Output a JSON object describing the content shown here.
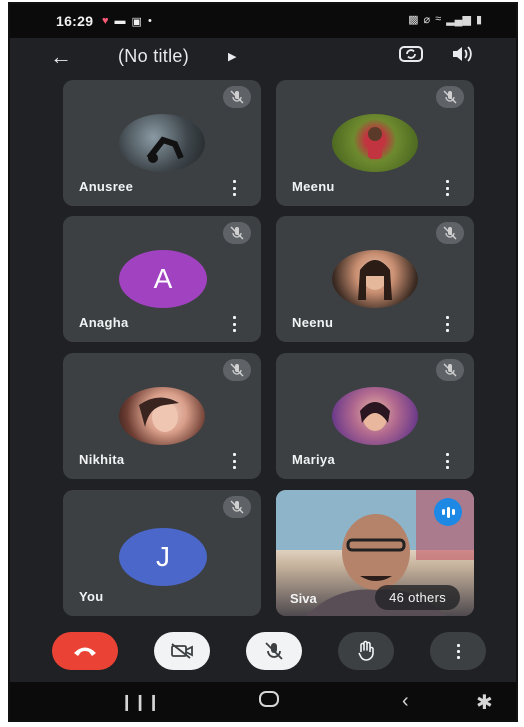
{
  "status_bar": {
    "time": "16:29"
  },
  "header": {
    "back_icon": "arrow-left-icon",
    "title": "(No title)"
  },
  "participants": [
    {
      "name": "Anusree",
      "avatar": "photo",
      "muted": true
    },
    {
      "name": "Meenu",
      "avatar": "photo",
      "muted": true
    },
    {
      "name": "Anagha",
      "avatar_letter": "A",
      "avatar_color": "#a142c0",
      "muted": true
    },
    {
      "name": "Neenu",
      "avatar": "photo",
      "muted": true
    },
    {
      "name": "Nikhita",
      "avatar": "photo",
      "muted": true
    },
    {
      "name": "Mariya",
      "avatar": "photo",
      "muted": true
    },
    {
      "name": "You",
      "avatar_letter": "J",
      "avatar_color": "#4a67c9",
      "muted": true
    }
  ],
  "active_speaker": {
    "name": "Siva",
    "others_label": "46 others"
  },
  "controls": {
    "end_call_color": "#ea4335",
    "camera": "camera-off",
    "mic": "mic-off",
    "hand": "raise-hand",
    "more": "more"
  }
}
